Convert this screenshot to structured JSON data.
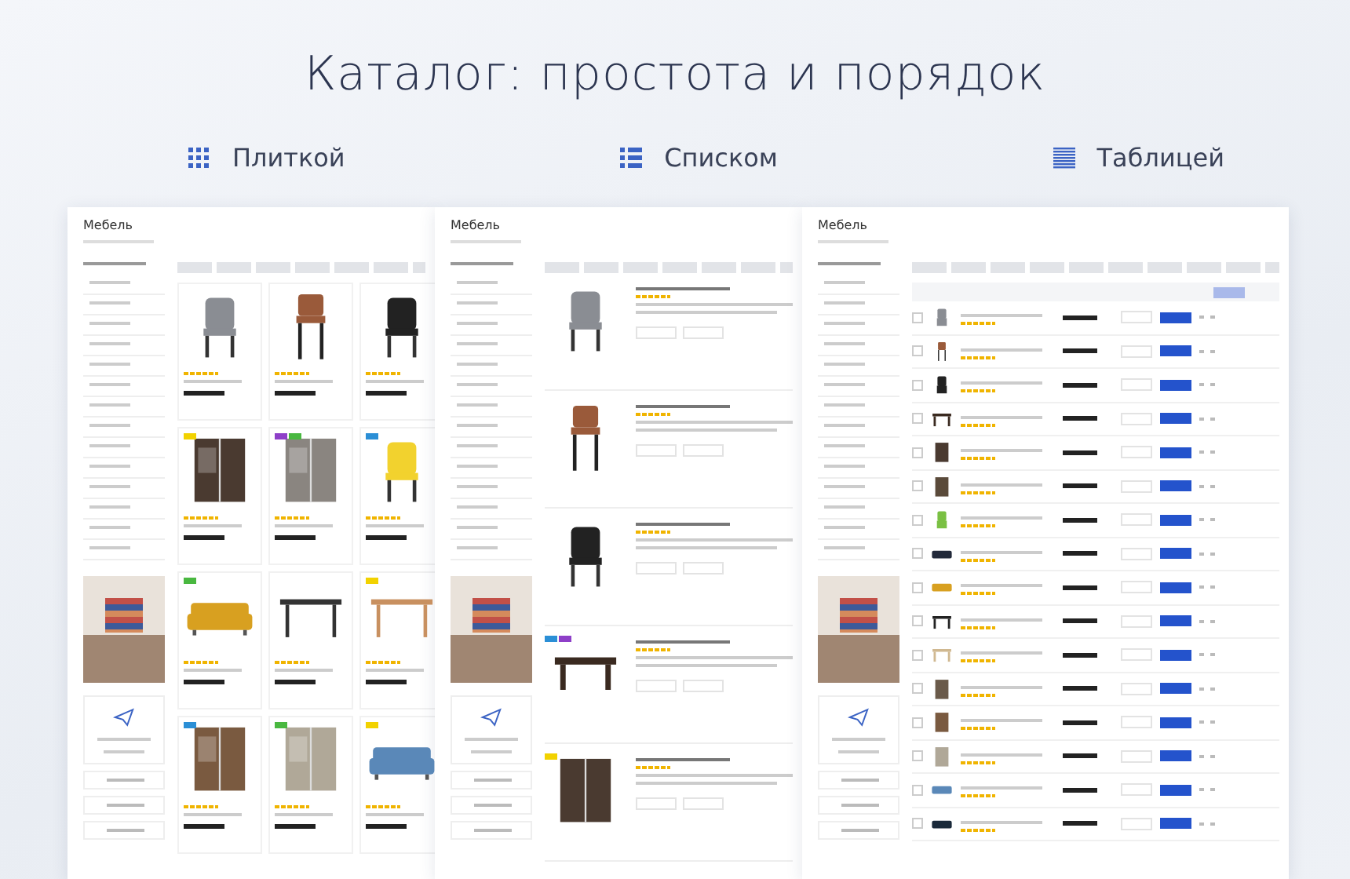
{
  "title": "Каталог: простота и порядок",
  "views": [
    {
      "label": "Плиткой"
    },
    {
      "label": "Списком"
    },
    {
      "label": "Таблицей"
    }
  ],
  "panels": [
    {
      "kind": "tiles",
      "heading": "Мебель",
      "products": [
        {
          "kind": "chair",
          "color": "#8a8d93"
        },
        {
          "kind": "stool",
          "color": "#9a5a3a"
        },
        {
          "kind": "chair",
          "color": "#222222"
        },
        {
          "kind": "cabinet",
          "color": "#4a3a30",
          "badges": [
            {
              "color": "#f2d200"
            }
          ]
        },
        {
          "kind": "cabinet",
          "color": "#8a8580",
          "badges": [
            {
              "color": "#8e3fc8"
            },
            {
              "color": "#49b840"
            }
          ]
        },
        {
          "kind": "chair",
          "color": "#f2d22e",
          "badges": [
            {
              "color": "#2b8fd6"
            }
          ]
        },
        {
          "kind": "sofa",
          "color": "#d8a020",
          "badges": [
            {
              "color": "#49b840"
            }
          ]
        },
        {
          "kind": "table",
          "color": "#333333"
        },
        {
          "kind": "table",
          "color": "#c89060",
          "badges": [
            {
              "color": "#f2d200"
            }
          ]
        },
        {
          "kind": "cabinet",
          "color": "#7a5a40",
          "badges": [
            {
              "color": "#2b8fd6"
            }
          ]
        },
        {
          "kind": "cabinet",
          "color": "#b0a898",
          "badges": [
            {
              "color": "#49b840"
            }
          ]
        },
        {
          "kind": "sofa",
          "color": "#5a88b8",
          "badges": [
            {
              "color": "#f2d200"
            }
          ]
        }
      ]
    },
    {
      "kind": "list",
      "heading": "Мебель",
      "products": [
        {
          "kind": "chair",
          "color": "#8a8d93"
        },
        {
          "kind": "stool",
          "color": "#9a5a3a"
        },
        {
          "kind": "chair",
          "color": "#222222"
        },
        {
          "kind": "table",
          "color": "#3a2a20",
          "badges": [
            {
              "color": "#2b8fd6"
            },
            {
              "color": "#8e3fc8"
            }
          ]
        },
        {
          "kind": "cabinet",
          "color": "#4a3a30",
          "badges": [
            {
              "color": "#f2d200"
            }
          ]
        }
      ]
    },
    {
      "kind": "table",
      "heading": "Мебель",
      "products": [
        {
          "kind": "chair",
          "color": "#8a8d93",
          "checked": false
        },
        {
          "kind": "stool",
          "color": "#9a5a3a",
          "checked": false
        },
        {
          "kind": "chair",
          "color": "#222222",
          "checked": false
        },
        {
          "kind": "table",
          "color": "#3a2a20",
          "checked": false
        },
        {
          "kind": "cabinet",
          "color": "#4a3a30",
          "checked": false
        },
        {
          "kind": "cabinet",
          "color": "#5a4a3a",
          "checked": false
        },
        {
          "kind": "chair",
          "color": "#7ac043",
          "checked": false
        },
        {
          "kind": "sofa",
          "color": "#222a3a",
          "checked": false
        },
        {
          "kind": "sofa",
          "color": "#d8a020",
          "checked": false
        },
        {
          "kind": "table",
          "color": "#222222",
          "checked": false
        },
        {
          "kind": "table",
          "color": "#d0b890",
          "checked": false
        },
        {
          "kind": "cabinet",
          "color": "#6a5a4a",
          "checked": false
        },
        {
          "kind": "cabinet",
          "color": "#7a5a40",
          "checked": false
        },
        {
          "kind": "cabinet",
          "color": "#b0a898",
          "checked": false
        },
        {
          "kind": "sofa",
          "color": "#5a88b8",
          "checked": false
        },
        {
          "kind": "sofa",
          "color": "#1a2a3a",
          "checked": false
        }
      ]
    }
  ]
}
